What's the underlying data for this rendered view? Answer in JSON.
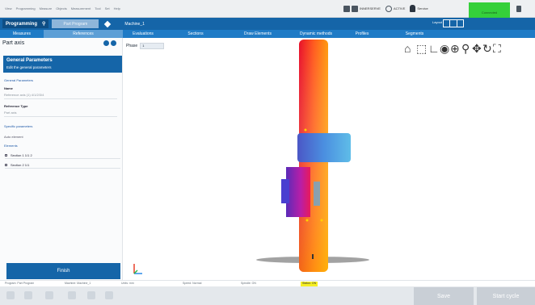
{
  "menubar": {
    "items": [
      "View",
      "Programming",
      "Measure",
      "Objects",
      "Measurement",
      "Tool",
      "Set",
      "Help"
    ],
    "status": [
      "INNERSERVE",
      "ACTIVE",
      "Service"
    ]
  },
  "green_box": {
    "line1": "Connected",
    "line2": "Ready"
  },
  "titlebar": {
    "programming": "Programming",
    "mode_button": "Part Program",
    "machine": "Machine_1",
    "layout": "Layout"
  },
  "tabs": [
    "Measures",
    "References",
    "Evaluations",
    "Sections",
    "Draw Elements",
    "Dynamic methods",
    "Profiles",
    "Segments"
  ],
  "panel": {
    "title": "Part axis",
    "header_title": "General Parameters",
    "header_sub": "Edit the general parameters",
    "section_general": "General Parameters",
    "name_label": "Name",
    "name_value": "Reference axis (1) 4/1/2/3/4",
    "reference_type_label": "Reference Type",
    "reference_type_value": "Part axis",
    "section_specific": "Specific parameters",
    "auto_option": "Auto element",
    "section_elements": "Elements",
    "elements": [
      "Section 1 1/1 2",
      "Section 2 1/1"
    ],
    "finish": "Finish"
  },
  "viewport": {
    "phase_label": "Phase",
    "phase_value": "1"
  },
  "status_strip": [
    "Program: Part Program",
    "Machine: Machine_1",
    "Units: mm",
    "Speed: Normal",
    "Spindle: ON",
    "Status: ON"
  ],
  "bottom": {
    "save": "Save",
    "start": "Start cycle"
  },
  "colors": {
    "primary": "#1565a8",
    "tab": "#1f7bc6",
    "accent_green": "#35d03a",
    "highlight_yellow": "#f6ef24"
  }
}
